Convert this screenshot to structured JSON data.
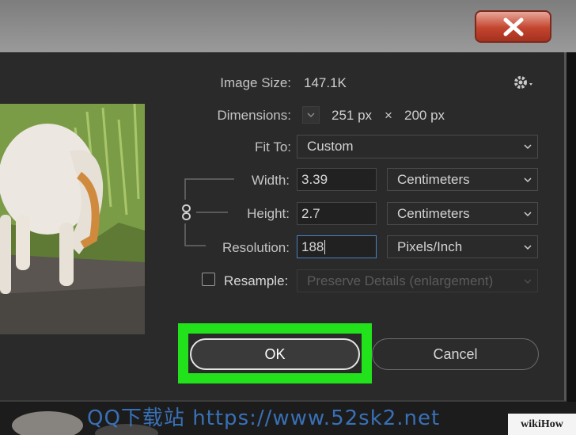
{
  "dialog": {
    "image_size": {
      "label": "Image Size:",
      "value": "147.1K"
    },
    "dimensions": {
      "label": "Dimensions:",
      "width": "251 px",
      "times": "×",
      "height": "200 px"
    },
    "fit_to": {
      "label": "Fit To:",
      "value": "Custom"
    },
    "width": {
      "label": "Width:",
      "value": "3.39",
      "unit": "Centimeters"
    },
    "height": {
      "label": "Height:",
      "value": "2.7",
      "unit": "Centimeters"
    },
    "resolution": {
      "label": "Resolution:",
      "value": "188",
      "unit": "Pixels/Inch"
    },
    "resample": {
      "label": "Resample:",
      "checked": false,
      "value": "Preserve Details (enlargement)"
    },
    "ok_label": "OK",
    "cancel_label": "Cancel"
  },
  "icons": {
    "close": "close-icon",
    "settings": "gear-icon",
    "link": "chain-link-icon",
    "dropdown": "chevron-down-icon"
  },
  "watermark": "QQ下载站 https://www.52sk2.net",
  "badge": "wikiHow",
  "colors": {
    "highlight": "#22e21c",
    "dialog_bg": "#2a2a2a",
    "close_button": "#c3452f",
    "focus_border": "#4a7fc4"
  }
}
